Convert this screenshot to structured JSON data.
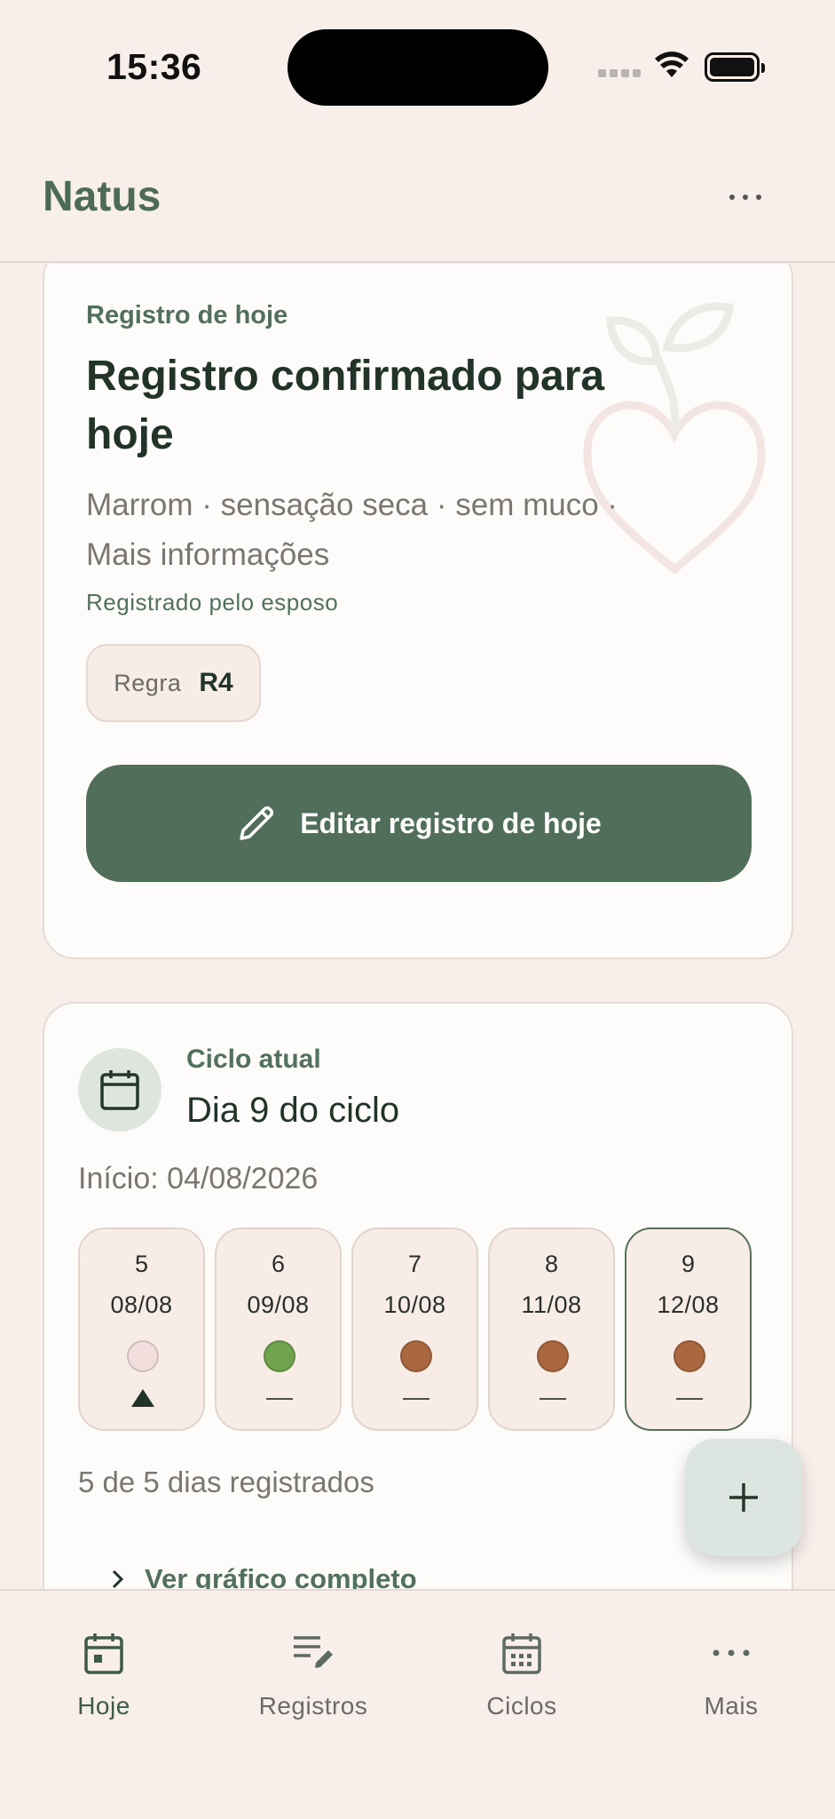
{
  "status_bar": {
    "time": "15:36"
  },
  "header": {
    "title": "Natus"
  },
  "today": {
    "kicker": "Registro de hoje",
    "title": "Registro confirmado para hoje",
    "summary": "Marrom · sensação seca · sem muco · Mais informações",
    "registered_by": "Registrado pelo esposo",
    "rule_label": "Regra",
    "rule_value": "R4",
    "edit_button": "Editar registro de hoje"
  },
  "cycle": {
    "kicker": "Ciclo atual",
    "day_label": "Dia 9 do ciclo",
    "start": "Início: 04/08/2026",
    "days": [
      {
        "num": "5",
        "date": "08/08",
        "color": "#f2dedd",
        "marker": "triangle"
      },
      {
        "num": "6",
        "date": "09/08",
        "color": "#6fa34d",
        "marker": "dash"
      },
      {
        "num": "7",
        "date": "10/08",
        "color": "#a9683f",
        "marker": "dash"
      },
      {
        "num": "8",
        "date": "11/08",
        "color": "#a9683f",
        "marker": "dash"
      },
      {
        "num": "9",
        "date": "12/08",
        "color": "#a9683f",
        "marker": "dash",
        "current": true
      }
    ],
    "count": "5 de 5 dias registrados",
    "see_chart": "Ver gráfico completo"
  },
  "nav": {
    "items": [
      {
        "label": "Hoje",
        "icon": "calendar-today-icon",
        "active": true
      },
      {
        "label": "Registros",
        "icon": "edit-list-icon"
      },
      {
        "label": "Ciclos",
        "icon": "calendar-grid-icon"
      },
      {
        "label": "Mais",
        "icon": "more-icon"
      }
    ]
  }
}
